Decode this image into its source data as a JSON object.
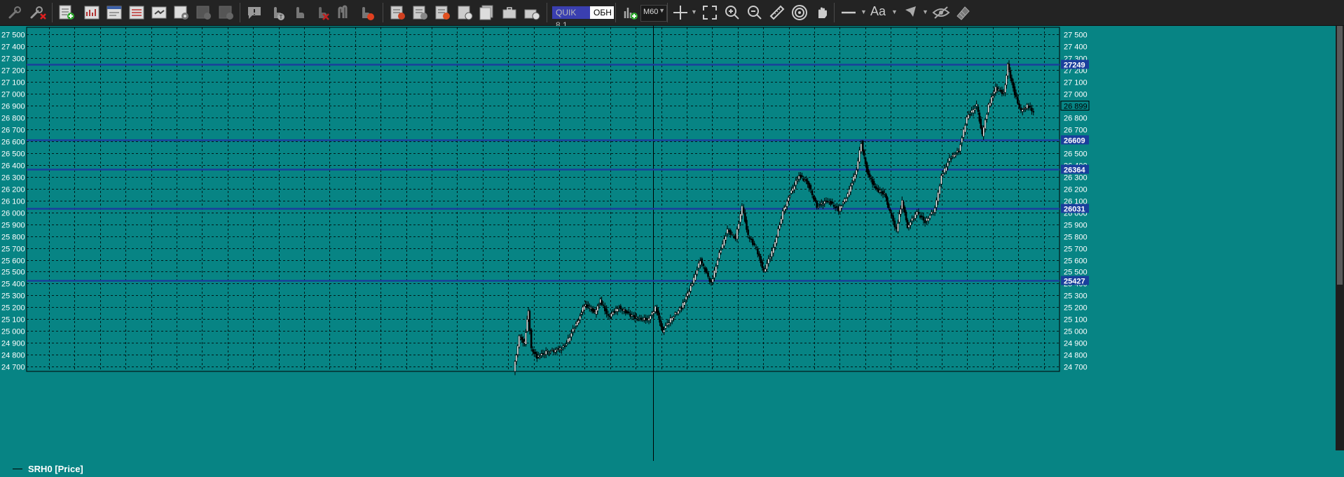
{
  "toolbar": {
    "quik_label": "QUIK 8.1",
    "obn_label": "ОБН",
    "interval": "M60",
    "font_label": "Aa"
  },
  "legend": {
    "label": "SRH0 [Price]"
  },
  "chart_data": {
    "type": "candlestick",
    "title": "",
    "series_name": "SRH0 [Price]",
    "ylim": [
      24660,
      27560
    ],
    "y_ticks": [
      24700,
      24800,
      24900,
      25000,
      25100,
      25200,
      25300,
      25400,
      25500,
      25600,
      25700,
      25800,
      25900,
      26000,
      26100,
      26200,
      26300,
      26400,
      26500,
      26600,
      26700,
      26800,
      26900,
      27000,
      27100,
      27200,
      27300,
      27400,
      27500
    ],
    "y_tick_labels": [
      "24 700",
      "24 800",
      "24 900",
      "25 000",
      "25 100",
      "25 200",
      "25 300",
      "25 400",
      "25 500",
      "25 600",
      "25 700",
      "25 800",
      "25 900",
      "26 000",
      "26 100",
      "26 200",
      "26 300",
      "26 400",
      "26 500",
      "26 600",
      "26 700",
      "26 800",
      "26 900",
      "27 000",
      "27 100",
      "27 200",
      "27 300",
      "27 400",
      "27 500"
    ],
    "levels": [
      27249,
      26609,
      26364,
      26031,
      25427
    ],
    "level_labels": [
      "27249",
      "26609",
      "26364",
      "26031",
      "25427"
    ],
    "current_price": 26899,
    "current_price_label": "26 899",
    "grid": true,
    "price_path": [
      [
        0.0,
        24660
      ],
      [
        0.01,
        24950
      ],
      [
        0.02,
        24900
      ],
      [
        0.027,
        25180
      ],
      [
        0.033,
        24850
      ],
      [
        0.043,
        24780
      ],
      [
        0.06,
        24820
      ],
      [
        0.08,
        24840
      ],
      [
        0.095,
        24870
      ],
      [
        0.11,
        25010
      ],
      [
        0.12,
        25100
      ],
      [
        0.13,
        25220
      ],
      [
        0.14,
        25200
      ],
      [
        0.15,
        25150
      ],
      [
        0.16,
        25260
      ],
      [
        0.175,
        25120
      ],
      [
        0.195,
        25200
      ],
      [
        0.21,
        25150
      ],
      [
        0.23,
        25100
      ],
      [
        0.25,
        25100
      ],
      [
        0.262,
        25200
      ],
      [
        0.275,
        25000
      ],
      [
        0.29,
        25100
      ],
      [
        0.31,
        25200
      ],
      [
        0.33,
        25400
      ],
      [
        0.345,
        25600
      ],
      [
        0.365,
        25400
      ],
      [
        0.38,
        25650
      ],
      [
        0.395,
        25850
      ],
      [
        0.41,
        25780
      ],
      [
        0.422,
        26050
      ],
      [
        0.433,
        25800
      ],
      [
        0.448,
        25700
      ],
      [
        0.462,
        25500
      ],
      [
        0.48,
        25700
      ],
      [
        0.497,
        26000
      ],
      [
        0.51,
        26150
      ],
      [
        0.527,
        26310
      ],
      [
        0.543,
        26250
      ],
      [
        0.56,
        26050
      ],
      [
        0.58,
        26100
      ],
      [
        0.6,
        26020
      ],
      [
        0.617,
        26150
      ],
      [
        0.633,
        26360
      ],
      [
        0.642,
        26590
      ],
      [
        0.652,
        26350
      ],
      [
        0.668,
        26200
      ],
      [
        0.685,
        26150
      ],
      [
        0.695,
        26000
      ],
      [
        0.707,
        25850
      ],
      [
        0.717,
        26100
      ],
      [
        0.727,
        25880
      ],
      [
        0.745,
        26000
      ],
      [
        0.76,
        25920
      ],
      [
        0.778,
        26030
      ],
      [
        0.79,
        26300
      ],
      [
        0.805,
        26450
      ],
      [
        0.822,
        26520
      ],
      [
        0.837,
        26800
      ],
      [
        0.855,
        26900
      ],
      [
        0.865,
        26650
      ],
      [
        0.877,
        26900
      ],
      [
        0.89,
        27050
      ],
      [
        0.905,
        27000
      ],
      [
        0.912,
        27240
      ],
      [
        0.925,
        27000
      ],
      [
        0.937,
        26850
      ],
      [
        0.948,
        26900
      ],
      [
        0.96,
        26850
      ]
    ]
  }
}
